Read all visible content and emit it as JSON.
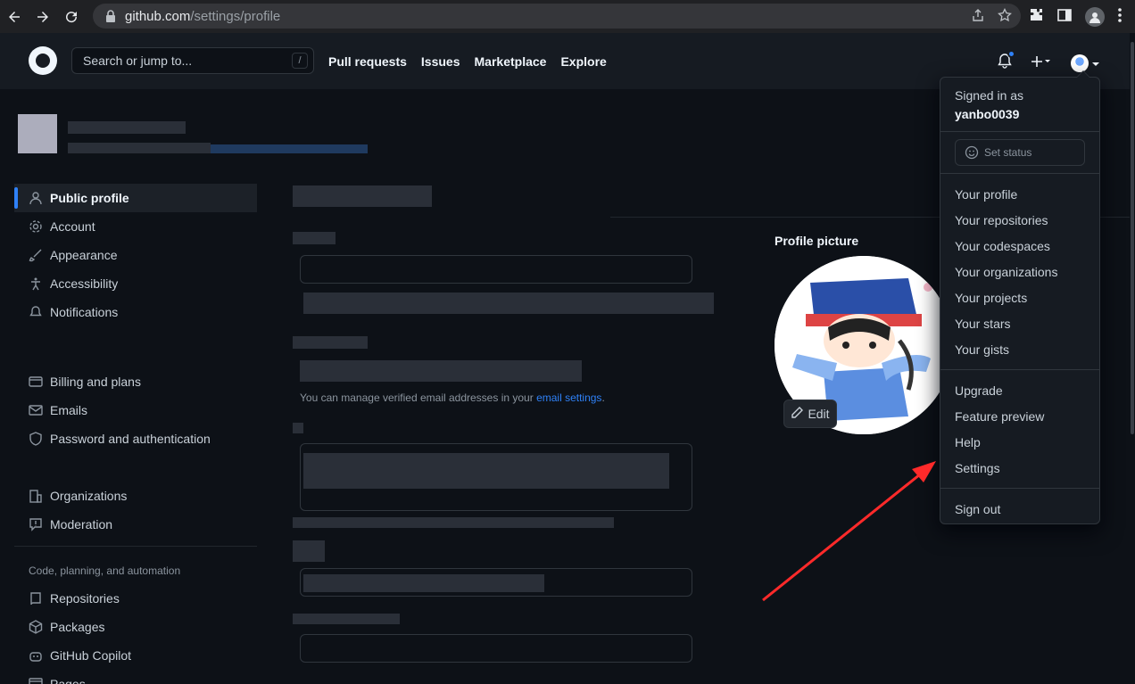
{
  "browser": {
    "url_host": "github.com",
    "url_path": "/settings/profile"
  },
  "header": {
    "search_placeholder": "Search or jump to...",
    "search_shortcut": "/",
    "nav": [
      "Pull requests",
      "Issues",
      "Marketplace",
      "Explore"
    ]
  },
  "sidebar": {
    "items": [
      "Public profile",
      "Account",
      "Appearance",
      "Accessibility",
      "Notifications",
      "Billing and plans",
      "Emails",
      "Password and authentication",
      "Organizations",
      "Moderation"
    ],
    "section_heading": "Code, planning, and automation",
    "section_items": [
      "Repositories",
      "Packages",
      "GitHub Copilot",
      "Pages"
    ]
  },
  "main": {
    "email_help": "You can manage verified email addresses in your",
    "email_link": "email settings",
    "profile_picture_label": "Profile picture",
    "edit_label": "Edit"
  },
  "dropdown": {
    "signed_in_as": "Signed in as",
    "username": "yanbo0039",
    "set_status": "Set status",
    "group1": [
      "Your profile",
      "Your repositories",
      "Your codespaces",
      "Your organizations",
      "Your projects",
      "Your stars",
      "Your gists"
    ],
    "group2": [
      "Upgrade",
      "Feature preview",
      "Help",
      "Settings"
    ],
    "sign_out": "Sign out"
  },
  "colors": {
    "accent": "#2f81f7",
    "annotation_arrow": "#ff2a2a"
  }
}
